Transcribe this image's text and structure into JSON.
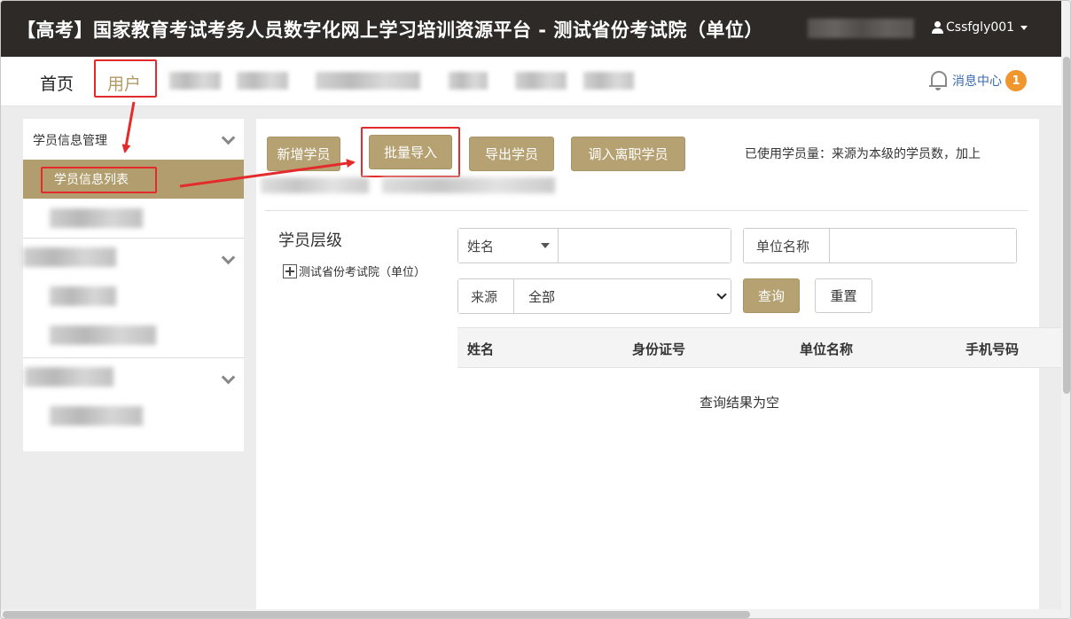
{
  "header": {
    "title": "【高考】国家教育考试考务人员数字化网上学习培训资源平台 - 测试省份考试院（单位）",
    "username": "Cssfgly001"
  },
  "nav": {
    "home": "首页",
    "user": "用户",
    "message_center": "消息中心",
    "message_count": "1"
  },
  "sidebar": {
    "group1_title": "学员信息管理",
    "active_item": "学员信息列表"
  },
  "toolbar": {
    "add_student": "新增学员",
    "batch_import": "批量导入",
    "export_students": "导出学员",
    "transfer_in": "调入离职学员",
    "usage_note": "已使用学员量：来源为本级的学员数，加上"
  },
  "tree": {
    "level_label": "学员层级",
    "root_node": "测试省份考试院（单位）"
  },
  "search": {
    "name_field": "姓名",
    "unit_field": "单位名称",
    "source_label": "来源",
    "source_value": "全部",
    "query_button": "查询",
    "reset_button": "重置"
  },
  "table": {
    "columns": [
      "姓名",
      "身份证号",
      "单位名称",
      "手机号码"
    ],
    "empty_message": "查询结果为空"
  },
  "colors": {
    "header_bg": "#2d2a27",
    "accent_gold": "#b5a171",
    "annotation_red": "#e42b2b",
    "badge_orange": "#f0962e"
  }
}
